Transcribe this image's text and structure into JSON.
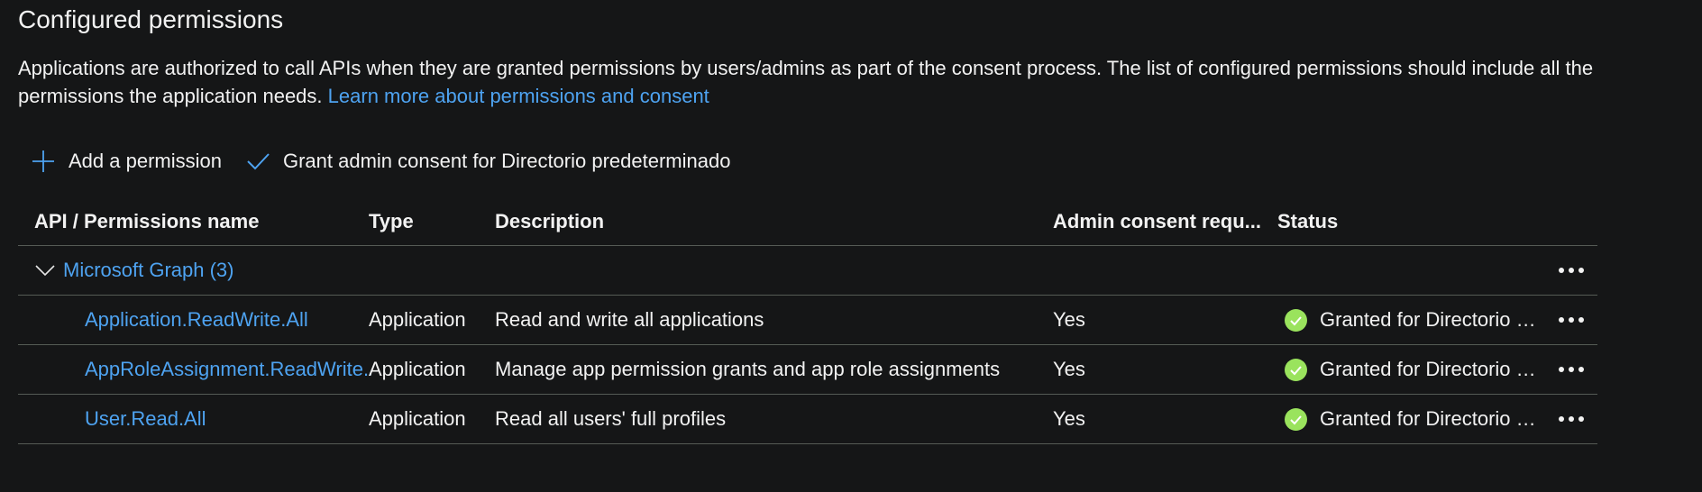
{
  "header": {
    "title": "Configured permissions",
    "description": "Applications are authorized to call APIs when they are granted permissions by users/admins as part of the consent process. The list of configured permissions should include all the permissions the application needs.",
    "learn_more_link": "Learn more about permissions and consent"
  },
  "toolbar": {
    "add_permission_label": "Add a permission",
    "grant_consent_label": "Grant admin consent for Directorio predeterminado",
    "add_icon": "plus-icon",
    "grant_icon": "checkmark-icon"
  },
  "table": {
    "columns": [
      "API / Permissions name",
      "Type",
      "Description",
      "Admin consent requ...",
      "Status"
    ],
    "group": {
      "label": "Microsoft Graph (3)",
      "expanded": true
    },
    "rows": [
      {
        "name": "Application.ReadWrite.All",
        "type": "Application",
        "description": "Read and write all applications",
        "admin_consent": "Yes",
        "status": "Granted for Directorio p..."
      },
      {
        "name": "AppRoleAssignment.ReadWrite.All",
        "type": "Application",
        "description": "Manage app permission grants and app role assignments",
        "admin_consent": "Yes",
        "status": "Granted for Directorio p..."
      },
      {
        "name": "User.Read.All",
        "type": "Application",
        "description": "Read all users' full profiles",
        "admin_consent": "Yes",
        "status": "Granted for Directorio p..."
      }
    ]
  },
  "colors": {
    "background": "#151617",
    "link": "#4ea3f1",
    "success": "#9ae35d",
    "divider": "#555b55"
  }
}
